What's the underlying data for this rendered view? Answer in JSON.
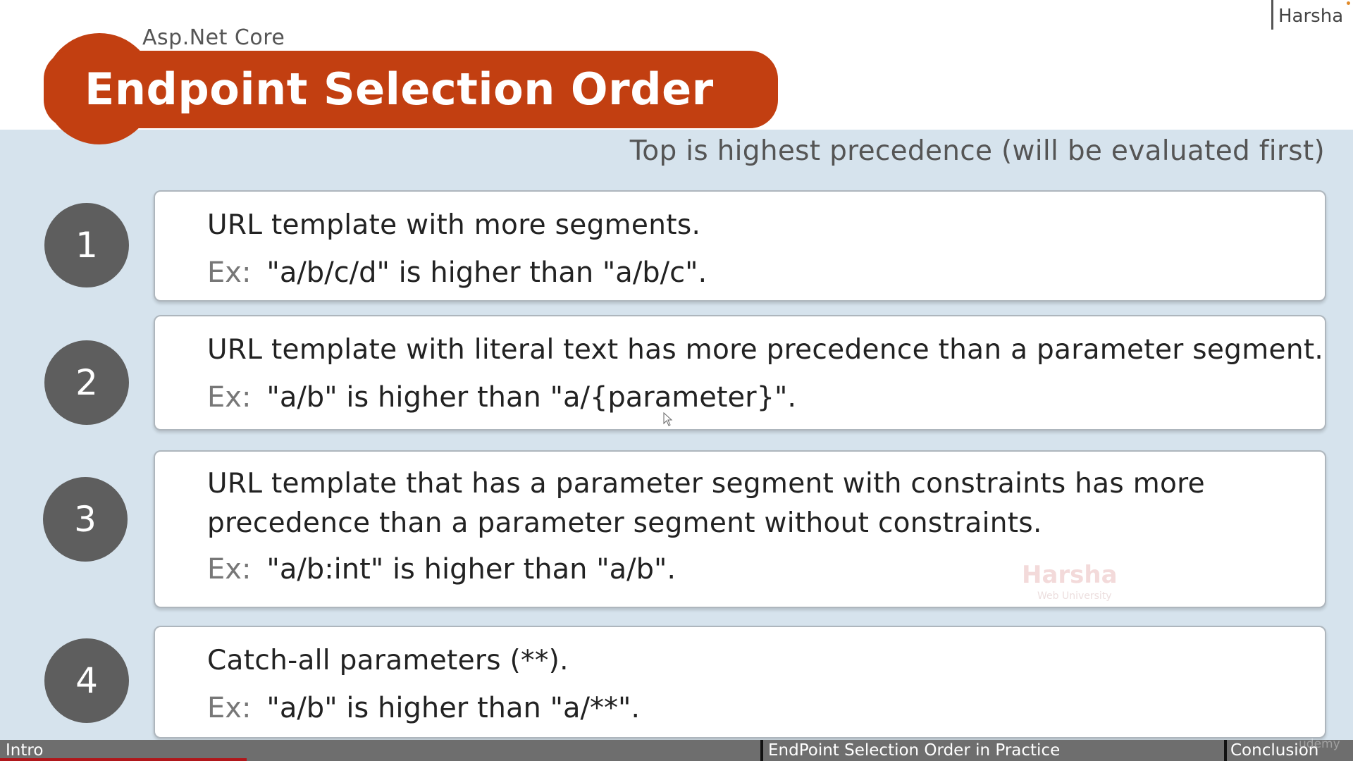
{
  "header": {
    "course": "Asp.Net Core",
    "title": "Endpoint Selection Order",
    "author": "Harsha"
  },
  "subtitle": "Top is highest precedence (will be evaluated first)",
  "rules": [
    {
      "number": "1",
      "description": "URL template with more segments.",
      "example_label": "Ex:",
      "example": "\"a/b/c/d\" is higher than \"a/b/c\"."
    },
    {
      "number": "2",
      "description": "URL template with literal text has more precedence than a parameter segment.",
      "example_label": "Ex:",
      "example": "\"a/b\" is higher than \"a/{parameter}\"."
    },
    {
      "number": "3",
      "description_line1": "URL template that has a parameter segment with constraints has more",
      "description_line2": "precedence than a parameter segment without constraints.",
      "example_label": "Ex:",
      "example": "\"a/b:int\" is higher than \"a/b\"."
    },
    {
      "number": "4",
      "description": "Catch-all parameters (**).",
      "example_label": "Ex:",
      "example": "\"a/b\" is higher than \"a/**\"."
    }
  ],
  "watermark": {
    "name": "Harsha",
    "sub": "Web University"
  },
  "bottom_nav": {
    "items": [
      "Intro",
      "EndPoint Selection Order in Practice",
      "Conclusion"
    ],
    "brand": "udemy"
  },
  "colors": {
    "title_bar": "#c23f11",
    "content_background": "#d6e3ed",
    "number_circle": "#5e5e5e",
    "nav_bar": "#6e6e6e",
    "progress": "#b0171b"
  }
}
